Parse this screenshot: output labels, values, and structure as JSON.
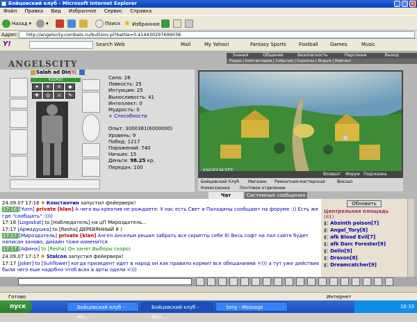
{
  "window": {
    "title": "Бойцовский клуб - Microsoft Internet Explorer"
  },
  "menu": [
    "Файл",
    "Правка",
    "Вид",
    "Избранное",
    "Сервис",
    "Справка"
  ],
  "toolbar": {
    "back": "Назад",
    "search": "Поиск",
    "favorites": "Избранное"
  },
  "address": {
    "label": "Адрес:",
    "url": "http://angelscity.combats.ru/buttons.pl?battle=0.414430297699038"
  },
  "yahoo": {
    "search_btn": "Search Web",
    "items": [
      "Mail",
      "My Yahoo!",
      "Fantasy Sports",
      "Football",
      "Games",
      "Music"
    ]
  },
  "game": {
    "logo": "ANGELSCITY",
    "topnav": [
      "Знания",
      "Общение",
      "Безопасность",
      "Персонаж",
      "Выход"
    ],
    "subnav": [
      "Радио",
      "form-история",
      "События",
      "Скроллы",
      "Форум",
      "Рейтинг"
    ],
    "character": {
      "name": "Salah ad Din",
      "level": "[9]",
      "hp": "432/432"
    },
    "stats": [
      "Сила: 26",
      "Ловкость: 25",
      "Интуиция: 25",
      "Выносливость: 41",
      "Интеллект: 0",
      "Мудрость: 0"
    ],
    "abilities": "+ Способности",
    "stats2": [
      "Опыт: 3000381(6000000)",
      "Уровень: 9",
      "Побед: 1217",
      "Поражений: 740",
      "Ничьих: 15"
    ],
    "money_label": "Деньги: ",
    "money_value": "98.25",
    "money_unit": " кр.",
    "transfers": "Передач: 100",
    "scene_logo": "ANGELSCITY",
    "scene_links": [
      "Возврат",
      "Форум",
      "Подсказка"
    ],
    "locations": [
      "Бойцовский Клуб",
      "Магазин",
      "Ремонтная мастерская",
      "Вокзал",
      "Комиссионка",
      "Почтовое отделение"
    ],
    "tabs": [
      "Чат",
      "Системные сообщения"
    ],
    "refresh_btn": "Обновить",
    "online_title": "Центральная площадь",
    "online_count": "(81)",
    "players": [
      "Absinth poison[7]",
      "Angel_Tory[8]",
      "afk Blood Evil[7]",
      "afk Darc Forester[9]",
      "Delin[9]",
      "Draxon[8]",
      "Dreamcatcher[9]"
    ]
  },
  "chat": [
    {
      "time": "24.09.07 17:16",
      "nick": "Константин",
      "text": " запустил фейерверк!",
      "special": true
    },
    {
      "time": "17:16",
      "nick": "[Yunn]",
      "priv": " private [klan]",
      "text": " А чего вы креатив не рождаете: У нас есть Свет и Паладины сообщают на форуме :)) Есть же где \"сообщать\" :))))",
      "color": "blu",
      "marked": true
    },
    {
      "time": "17:16",
      "nick": "[Logoskat]",
      "text": " to [Наблюдатель] на цП Мироздатель..."
    },
    {
      "time": "17:17",
      "nick": "[Армадушка]",
      "text": " to [Resha] ДЕРЕВЯННЫЙ 8 )"
    },
    {
      "time": "17:17",
      "nick": "[Мироздатель]",
      "priv": " private [klan]",
      "text": " Ангел Ансельм решил забрать все скрипты себе 8) Весь софт на пал сайте будет написан заново, дизайн тоже изменится",
      "color": "blu",
      "marked": true
    },
    {
      "time": "17:17",
      "nick": "[Афина]",
      "text": " to [Resha] Он занят.Выборы скоро)",
      "color": "grn",
      "marked": true
    },
    {
      "time": "24.09.07 17:17",
      "nick": "Stalcon",
      "text": " запустил фейерверк!",
      "special": true
    },
    {
      "time": "17:17",
      "nick": "[Joker]",
      "text": " to [Sunflower] когда призедент идет в народ он как правило кормит все обешаниями =))) а тут уже действия были чего еше надобно чтоб всех в арты одели =)))",
      "color": "blu"
    }
  ],
  "statusbar": {
    "status": "Готово",
    "zone": "Интернет"
  },
  "taskbar": {
    "start": "пуск",
    "tasks": [
      "Бойцовский клуб - Mic...",
      "Бойцовский клуб - Micr...",
      "Serg - Message"
    ],
    "time": "16:33"
  },
  "colors": {
    "title_blue": "#0a3fb8",
    "chat_private": "#aa0000",
    "chat_to_green": "#008800",
    "chat_nick_blue": "#0000aa"
  }
}
